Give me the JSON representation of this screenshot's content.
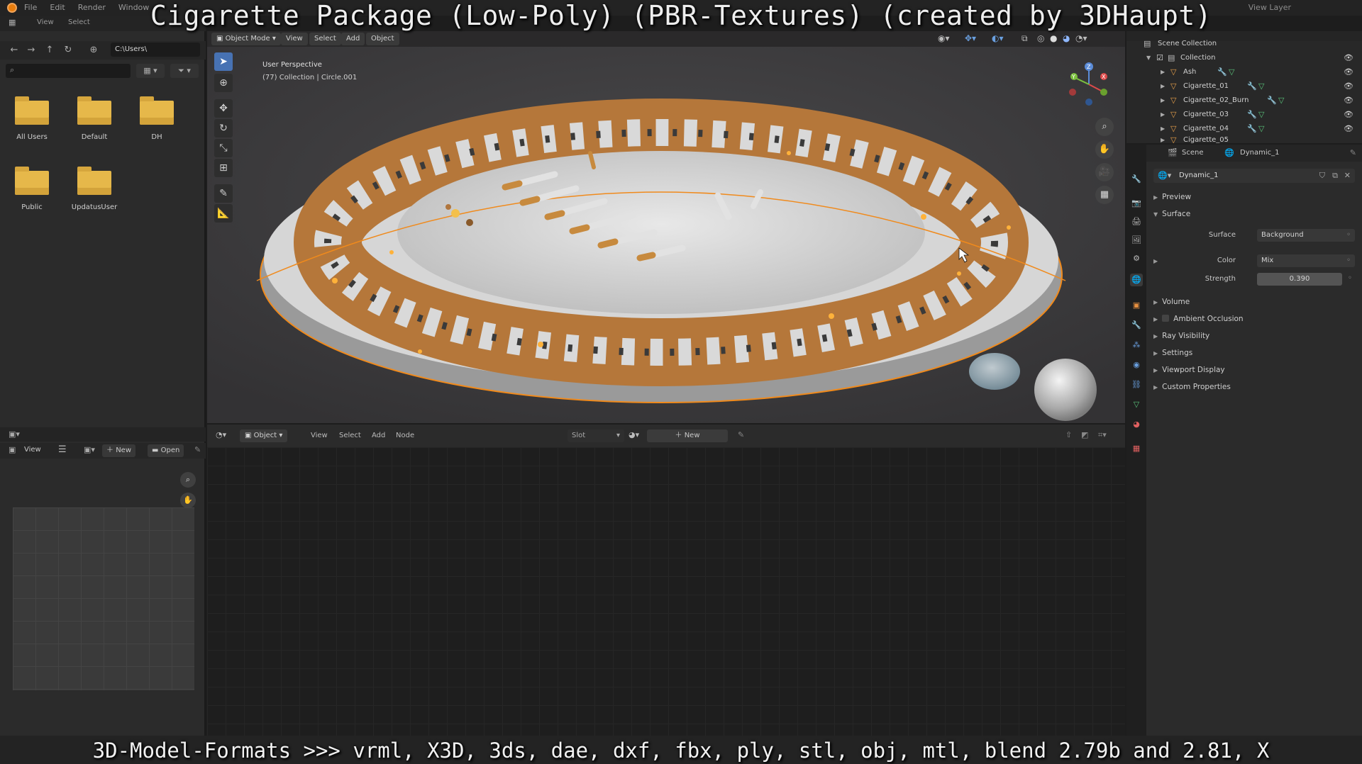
{
  "overlay": {
    "title": "Cigarette Package (Low-Poly) (PBR-Textures) (created by 3DHaupt)",
    "formats": "3D-Model-Formats >>> vrml, X3D, 3ds, dae, dxf, fbx, ply, stl, obj, mtl, blend 2.79b and 2.81, X"
  },
  "topbar": {
    "menu": [
      "File",
      "Edit",
      "Render",
      "Window"
    ],
    "view_layer": "View Layer"
  },
  "file_browser": {
    "header_menu": [
      "View",
      "Select"
    ],
    "path": "C:\\Users\\",
    "folders": [
      "All Users",
      "Default",
      "DH",
      "Public",
      "UpdatusUser"
    ]
  },
  "image_editor": {
    "view_label": "View",
    "new_label": "New",
    "open_label": "Open"
  },
  "viewport": {
    "mode": "Object Mode",
    "menu": [
      "View",
      "Select",
      "Add",
      "Object"
    ],
    "perspective_label": "User Perspective",
    "collection_label": "(77) Collection | Circle.001",
    "gizmo_axes": {
      "z": "Z",
      "y": "Y",
      "x": "X"
    }
  },
  "node_editor": {
    "object_label": "Object",
    "menu": [
      "View",
      "Select",
      "Add",
      "Node"
    ],
    "slot_label": "Slot",
    "new_label": "New"
  },
  "outliner": {
    "scene_collection": "Scene Collection",
    "collection": "Collection",
    "objects": [
      "Ash",
      "Cigarette_01",
      "Cigarette_02_Burn",
      "Cigarette_03",
      "Cigarette_04",
      "Cigarette_05"
    ]
  },
  "properties": {
    "scene_label": "Scene",
    "world_label": "Dynamic_1",
    "world_name": "Dynamic_1",
    "panels": {
      "preview": "Preview",
      "surface": "Surface"
    },
    "surface_field_label": "Surface",
    "surface_value": "Background",
    "color_label": "Color",
    "color_value": "Mix",
    "strength_label": "Strength",
    "strength_value": "0.390",
    "subpanels": [
      "Volume",
      "Ambient Occlusion",
      "Ray Visibility",
      "Settings",
      "Viewport Display",
      "Custom Properties"
    ]
  },
  "colors": {
    "accent": "#4772b3",
    "blender_orange": "#e87d0d",
    "folder": "#e6b84a",
    "selection_outline": "#f08a1c"
  }
}
